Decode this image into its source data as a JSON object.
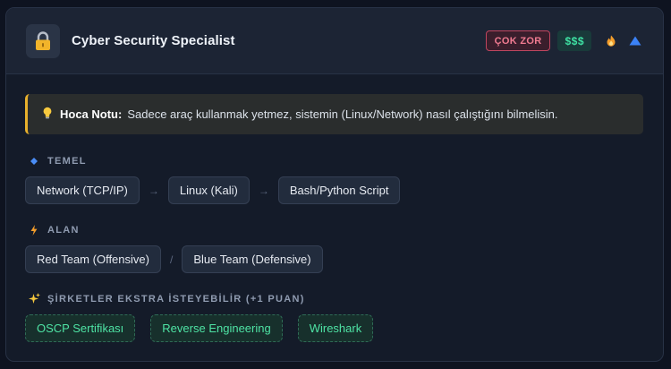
{
  "header": {
    "title": "Cyber Security Specialist",
    "difficulty": "ÇOK ZOR",
    "cost": "$$$",
    "icons": {
      "main": "lock-icon",
      "hot": "fire-icon",
      "trend": "triangle-up-icon"
    },
    "colors": {
      "difficulty": "#f07b91",
      "cost": "#3ee0a2",
      "trend": "#3b82f6"
    }
  },
  "note": {
    "label": "Hoca Notu:",
    "text": "Sadece araç kullanmak yetmez, sistemin (Linux/Network) nasıl çalıştığını bilmelisin.",
    "icon": "lightbulb-icon",
    "accent": "#e8b02c"
  },
  "sections": {
    "foundation": {
      "title": "TEMEL",
      "icon": "diamond-icon",
      "separator": "→",
      "items": [
        "Network (TCP/IP)",
        "Linux (Kali)",
        "Bash/Python Script"
      ]
    },
    "field": {
      "title": "ALAN",
      "icon": "lightning-icon",
      "separator": "/",
      "items": [
        "Red Team (Offensive)",
        "Blue Team (Defensive)"
      ]
    },
    "extras": {
      "title": "ŞİRKETLER EKSTRA İSTEYEBİLİR (+1 PUAN)",
      "icon": "sparkles-icon",
      "items": [
        "OSCP Sertifikası",
        "Reverse Engineering",
        "Wireshark"
      ]
    }
  }
}
